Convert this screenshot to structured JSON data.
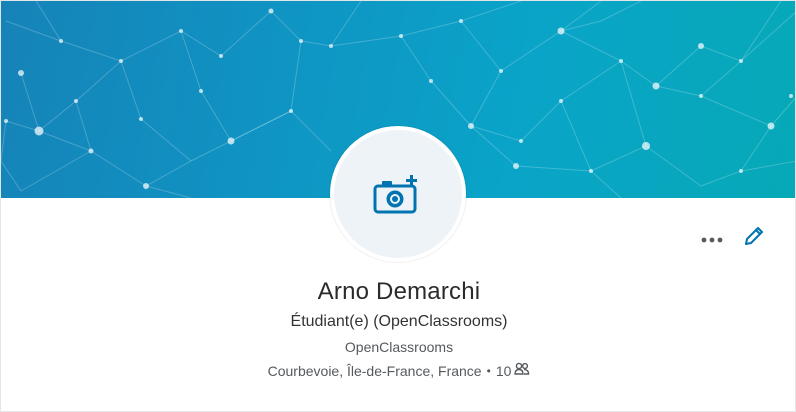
{
  "profile": {
    "name": "Arno Demarchi",
    "headline": "Étudiant(e) (OpenClassrooms)",
    "company": "OpenClassrooms",
    "location": "Courbevoie, Île-de-France, France",
    "separator": "•",
    "connections_count": "10"
  },
  "icons": {
    "avatar": "camera-add-icon",
    "more": "more-horizontal-icon",
    "edit": "pencil-icon",
    "connections": "people-icon"
  },
  "colors": {
    "banner_start": "#1683b8",
    "banner_end": "#06a9b7",
    "accent": "#0073b1",
    "text_primary": "#2b2b2b",
    "text_secondary": "#555a5e"
  }
}
